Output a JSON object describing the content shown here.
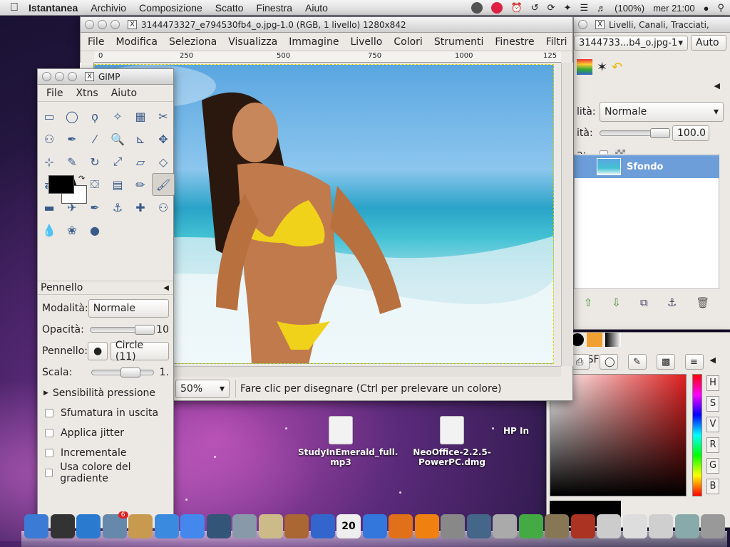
{
  "menubar": {
    "app": "Istantanea",
    "items": [
      "Archivio",
      "Composizione",
      "Scatto",
      "Finestra",
      "Aiuto"
    ],
    "battery": "(100%)",
    "clock": "mer 21:00"
  },
  "image_window": {
    "title": "3144473327_e794530fb4_o.jpg-1.0 (RGB, 1 livello) 1280x842",
    "menu": [
      "File",
      "Modifica",
      "Seleziona",
      "Visualizza",
      "Immagine",
      "Livello",
      "Colori",
      "Strumenti",
      "Finestre",
      "Filtri"
    ],
    "ruler_ticks": [
      "0",
      "250",
      "500",
      "750",
      "1000",
      "125"
    ],
    "zoom": "50%",
    "status": "Fare clic per disegnare (Ctrl per prelevare un colore)"
  },
  "toolbox": {
    "title": "GIMP",
    "menu": [
      "File",
      "Xtns",
      "Aiuto"
    ],
    "tool_icons": [
      "rect-select-icon",
      "ellipse-select-icon",
      "lasso-icon",
      "fuzzy-select-icon",
      "color-select-icon",
      "scissors-icon",
      "foreground-select-icon",
      "paths-icon",
      "color-picker-icon",
      "zoom-icon",
      "measure-icon",
      "move-icon",
      "align-icon",
      "crop-icon",
      "rotate-icon",
      "scale-icon",
      "shear-icon",
      "perspective-icon",
      "flip-icon",
      "text-icon",
      "bucket-fill-icon",
      "blend-icon",
      "pencil-icon",
      "paintbrush-icon",
      "eraser-icon",
      "airbrush-icon",
      "ink-icon",
      "clone-icon",
      "heal-icon",
      "perspective-clone-icon",
      "blur-icon",
      "smudge-icon",
      "dodge-burn-icon"
    ],
    "selected_tool": 23,
    "options_header": "Pennello",
    "mode_label": "Modalità:",
    "mode_value": "Normale",
    "opacity_label": "Opacità:",
    "opacity_value": "10",
    "brush_label": "Pennello:",
    "brush_value": "Circle (11)",
    "scale_label": "Scala:",
    "scale_value": "1.",
    "pressure": "Sensibilità pressione",
    "checks": [
      "Sfumatura in uscita",
      "Applica jitter",
      "Incrementale",
      "Usa colore del gradiente"
    ]
  },
  "layers_window": {
    "title": "Livelli, Canali, Tracciati, ",
    "image_combo": "3144733...b4_o.jpg-1",
    "auto_button": "Auto",
    "mode_label": "lità:",
    "mode_value": "Normale",
    "opacity_label": "ità:",
    "opacity_value": "100.0",
    "lock_label": "a:",
    "layer_name": "Sfondo"
  },
  "colors_window": {
    "header": "e PP/SF",
    "hsv": [
      "H",
      "S",
      "V",
      "R",
      "G",
      "B"
    ]
  },
  "desktop": {
    "icons": [
      {
        "name": "StudyInEmerald_full.\nmp3",
        "line1": "StudyInEmerald_full.",
        "line2": "mp3"
      },
      {
        "name": "NeoOffice-2.2.5-\nPowerPC.dmg",
        "line1": "NeoOffice-2.2.5-",
        "line2": "PowerPC.dmg"
      },
      {
        "name": "HP In",
        "line1": "HP In",
        "line2": ""
      }
    ]
  },
  "dock": {
    "badge": "6",
    "calendar_day": "20"
  }
}
